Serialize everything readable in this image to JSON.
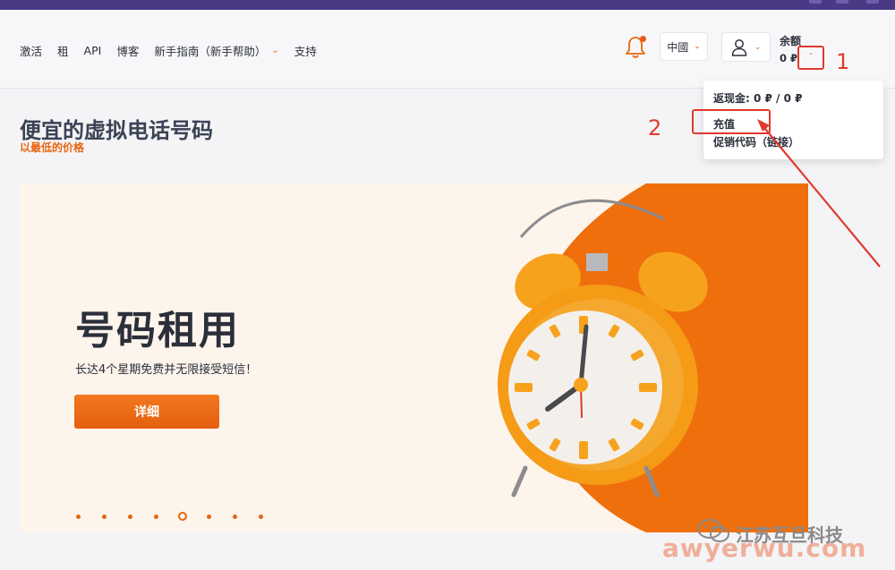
{
  "nav": {
    "items": [
      {
        "label": "激活"
      },
      {
        "label": "租"
      },
      {
        "label": "API"
      },
      {
        "label": "博客"
      },
      {
        "label": "新手指南（新手帮助）",
        "has_dropdown": true
      },
      {
        "label": "支持"
      }
    ]
  },
  "header": {
    "language": "中國",
    "balance_label": "余额",
    "balance_value": "0 ₽"
  },
  "dropdown": {
    "cashback": "返现金: 0 ₽ / 0 ₽",
    "recharge": "充值",
    "promo": "促销代码（链接）"
  },
  "annotations": {
    "step1": "1",
    "step2": "2",
    "color": "#e03a2c"
  },
  "page": {
    "title": "便宜的虚拟电话号码",
    "subtitle": "以最低的价格"
  },
  "banner": {
    "heading": "号码租用",
    "description": "长达4个星期免费并无限接受短信！",
    "button_label": "详细",
    "slide_count": 8,
    "active_slide": 5
  },
  "watermark": {
    "brand": "江苏互旦科技",
    "site": "awyerwu.com"
  },
  "colors": {
    "accent": "#e8650f",
    "top_bar": "#4a3a86",
    "banner_bg": "#fdf4ec",
    "clock_orange": "#f5a12a"
  },
  "icons": [
    "bell-icon",
    "user-icon",
    "chevron-down-icon",
    "chevron-up-icon",
    "wechat-icon",
    "alarm-clock-illustration"
  ]
}
